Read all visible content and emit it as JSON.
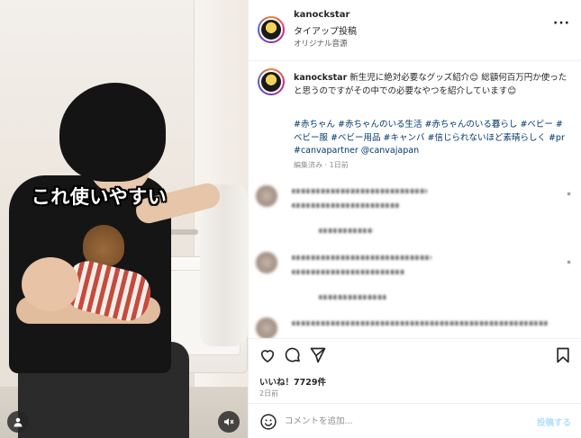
{
  "media": {
    "caption_overlay": "これ使いやすい",
    "user_tag_icon": "person-icon",
    "mute_icon": "muted-speaker-icon"
  },
  "header": {
    "username": "kanockstar",
    "subtitle": "タイアップ投稿",
    "audio": "オリジナル音源",
    "more_icon": "ellipsis-icon",
    "more_label": "···"
  },
  "caption": {
    "username": "kanockstar",
    "text": "新生児に絶対必要なグッズ紹介😊 総額何百万円か使ったと思うのですがその中での必要なやつを紹介しています😊",
    "hashtags": "#赤ちゃん #赤ちゃんのいる生活 #赤ちゃんのいる暮らし #ベビー #ベビー服 #ベビー用品 #キャンバ #信じられないほど素晴らしく #pr #canvapartner @canvajapan",
    "meta": "編集済み · 1日前"
  },
  "actions": {
    "like_icon": "heart-icon",
    "comment_icon": "comment-bubble-icon",
    "share_icon": "paper-plane-icon",
    "save_icon": "bookmark-icon",
    "likes": "いいね！7729件",
    "age": "2日前"
  },
  "composer": {
    "emoji_icon": "smiley-icon",
    "placeholder": "コメントを追加...",
    "post_label": "投稿する"
  },
  "colors": {
    "link": "#00376b",
    "muted": "#8e8e8e",
    "post_disabled": "#b2dffc"
  }
}
